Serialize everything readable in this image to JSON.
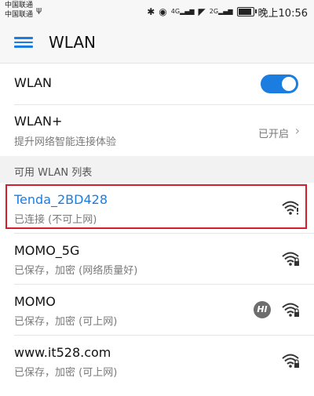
{
  "status_bar": {
    "carrier1": "中国联通",
    "carrier2": "中国联通",
    "usb_icon": "usb-icon",
    "icons": [
      "bluetooth-icon",
      "eye-icon",
      "signal-4g-icon",
      "wifi-status-icon",
      "signal-2g-icon",
      "battery-icon"
    ],
    "signal_4g_label": "4G",
    "signal_2g_label": "2G",
    "battery_level": 0.8,
    "time": "晚上10:56"
  },
  "app_bar": {
    "title": "WLAN",
    "menu_icon": "menu-icon"
  },
  "wlan_toggle": {
    "label": "WLAN",
    "enabled": true
  },
  "wlan_plus": {
    "label": "WLAN+",
    "subtitle": "提升网络智能连接体验",
    "status": "已开启"
  },
  "section": {
    "title": "可用 WLAN 列表"
  },
  "networks": [
    {
      "ssid": "Tenda_2BD428",
      "status": "已连接 (不可上网)",
      "locked": false,
      "warning": true,
      "connected": true
    },
    {
      "ssid": "MOMO_5G",
      "status": "已保存，加密 (网络质量好)",
      "locked": true,
      "warning": false,
      "connected": false
    },
    {
      "ssid": "MOMO",
      "status": "已保存，加密 (可上网)",
      "locked": true,
      "warning": false,
      "connected": false,
      "badge": "HI"
    },
    {
      "ssid": "www.it528.com",
      "status": "已保存，加密 (可上网)",
      "locked": true,
      "warning": false,
      "connected": false
    }
  ],
  "colors": {
    "accent": "#1b7ddf",
    "highlight_border": "#d41f2a",
    "secondary_text": "#7a7a7a"
  }
}
